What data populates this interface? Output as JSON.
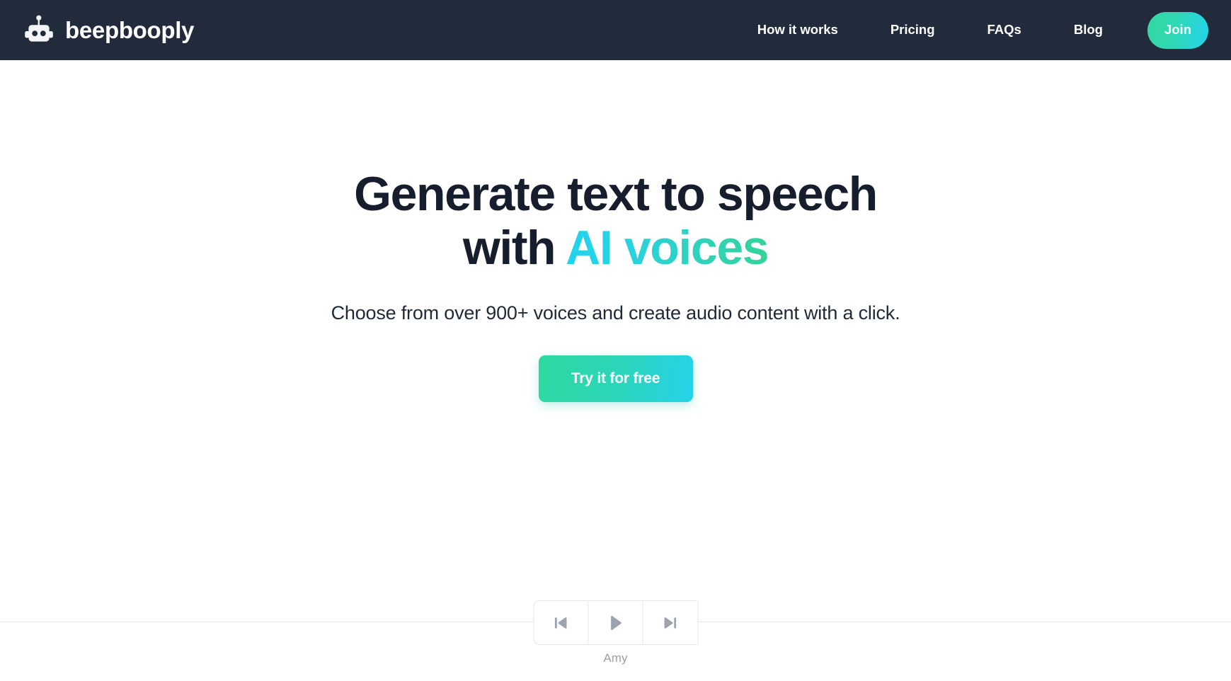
{
  "header": {
    "brand": {
      "logo_icon": "robot-head-icon",
      "name": "beepbooply"
    },
    "nav_links": [
      {
        "label": "How it works"
      },
      {
        "label": "Pricing"
      },
      {
        "label": "FAQs"
      },
      {
        "label": "Blog"
      }
    ],
    "join_label": "Join",
    "background_color": "#212b3b",
    "join_gradient_from": "#35d6a0",
    "join_gradient_to": "#23d3ee"
  },
  "hero": {
    "title_line1": "Generate text to speech",
    "title_line2_plain": "with ",
    "title_line2_accent": "AI voices",
    "subtitle": "Choose from over 900+ voices and create audio content with a click.",
    "cta_label": "Try it for free",
    "title_color": "#161e2e",
    "accent_gradient_from": "#22d3ee",
    "accent_gradient_to": "#34d399",
    "cta_gradient_from": "#2ed8a0",
    "cta_gradient_to": "#25d2ea"
  },
  "player": {
    "prev_icon": "skip-previous-icon",
    "play_icon": "play-icon",
    "next_icon": "skip-next-icon",
    "voice_name": "Amy",
    "icon_color": "#9ca3af",
    "border_color": "#e4e6ea"
  }
}
